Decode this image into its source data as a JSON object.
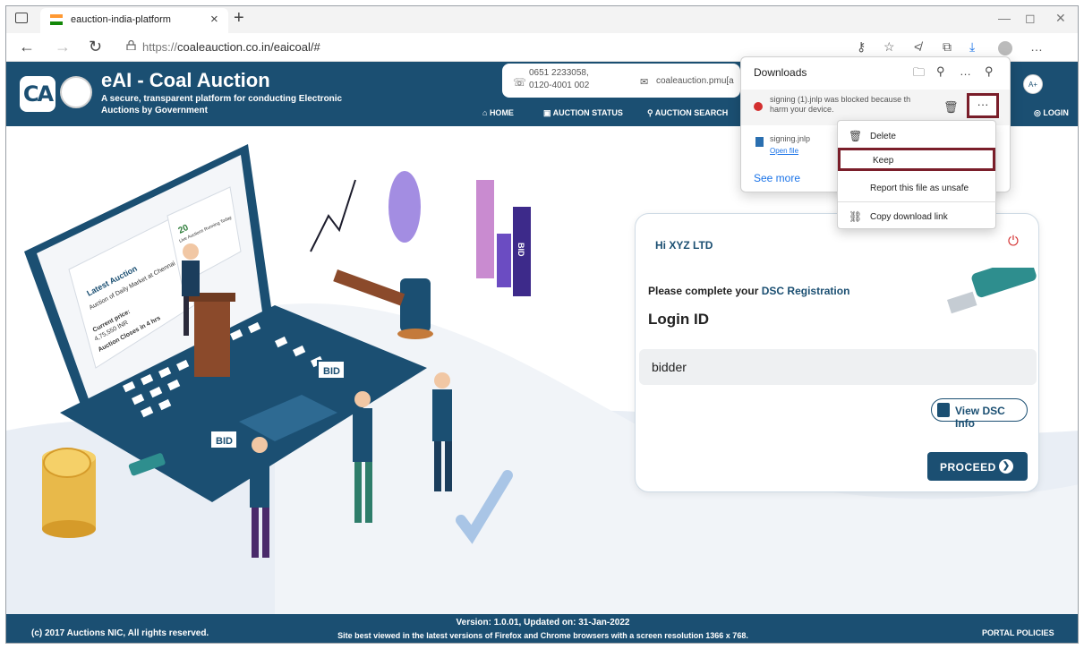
{
  "browser": {
    "tab_title": "eauction-india-platform",
    "url_prefix": "https://",
    "url_host": "coaleauction.co.in/eaicoal/#"
  },
  "site": {
    "brand_logo_text": "CA",
    "title": "eAI - Coal Auction",
    "subtitle": "A secure, transparent platform for conducting Electronic Auctions by Government",
    "phone": "0651 2233058,\n0120-4001 002",
    "email": "coaleauction.pmu[a",
    "font_size_label": "A+",
    "nav": {
      "home": "HOME",
      "auction_status": "AUCTION STATUS",
      "auction_search": "AUCTION SEARCH",
      "login": "LOGIN"
    }
  },
  "illustration": {
    "latest_auction": "Latest Auction",
    "market": "Auction of Daily Market at Chennai",
    "current_price_label": "Current price:",
    "current_price": "4,75,550 INR",
    "closes": "Auction Closes in 4 hrs",
    "count": "20",
    "count_caption": "Live Auctions Running Today",
    "bid_sign": "BID",
    "bid_vertical": "BID"
  },
  "login_card": {
    "greeting": "Hi XYZ LTD",
    "dsc_prompt": "Please complete your",
    "dsc_link": "DSC Registration",
    "login_label": "Login ID",
    "login_value": "bidder",
    "view_dsc": "View DSC Info",
    "proceed": "PROCEED"
  },
  "footer": {
    "copyright": "(c) 2017 Auctions NIC, All rights reserved.",
    "version": "Version: 1.0.01, Updated on: 31-Jan-2022",
    "best_view": "Site best viewed in the latest versions of Firefox and Chrome browsers with a screen resolution 1366 x 768.",
    "policies": "PORTAL POLICIES"
  },
  "downloads": {
    "title": "Downloads",
    "item1_msg": "signing (1).jnlp was blocked because th harm your device.",
    "item2_name": "signing.jnlp",
    "item2_open": "Open file",
    "see_more": "See more"
  },
  "context_menu": {
    "delete": "Delete",
    "keep": "Keep",
    "report": "Report this file as unsafe",
    "copy_link": "Copy download link"
  },
  "colors": {
    "brand": "#1b4f72",
    "highlight_box": "#7a1e2a",
    "blocked": "#d32f2f",
    "link": "#1a73e8"
  },
  "icons": [
    "tab-actions-icon",
    "close-icon",
    "plus-icon",
    "back-icon",
    "forward-icon",
    "refresh-icon",
    "lock-icon",
    "key-icon",
    "favorite-icon",
    "collections-icon",
    "download-icon",
    "profile-icon",
    "phone-icon",
    "mail-icon",
    "home-icon",
    "power-icon",
    "usb-token-icon",
    "document-icon",
    "arrow-right-icon",
    "folder-icon",
    "search-icon",
    "pin-icon",
    "blocked-icon",
    "trash-icon",
    "link-icon"
  ]
}
